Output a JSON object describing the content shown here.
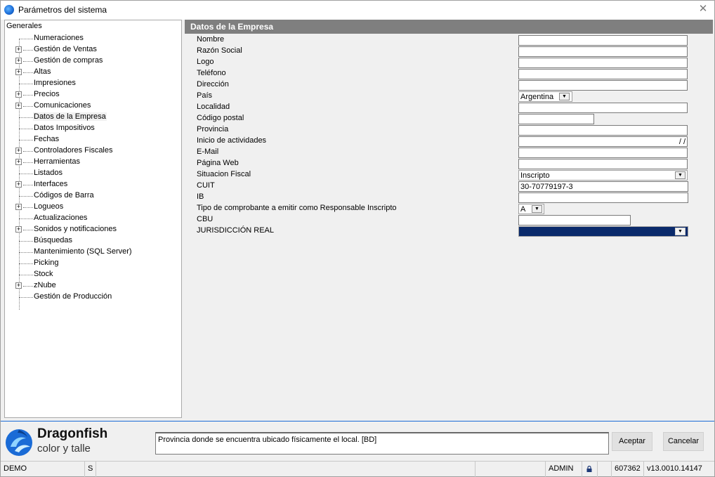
{
  "window": {
    "title": "Parámetros del sistema"
  },
  "tree": {
    "root": "Generales",
    "items": [
      {
        "label": "Numeraciones",
        "expandable": false
      },
      {
        "label": "Gestión de Ventas",
        "expandable": true
      },
      {
        "label": "Gestión de compras",
        "expandable": true
      },
      {
        "label": "Altas",
        "expandable": true
      },
      {
        "label": "Impresiones",
        "expandable": false
      },
      {
        "label": "Precios",
        "expandable": true
      },
      {
        "label": "Comunicaciones",
        "expandable": true
      },
      {
        "label": "Datos de la Empresa",
        "expandable": false,
        "selected": true
      },
      {
        "label": "Datos Impositivos",
        "expandable": false
      },
      {
        "label": "Fechas",
        "expandable": false
      },
      {
        "label": "Controladores Fiscales",
        "expandable": true
      },
      {
        "label": "Herramientas",
        "expandable": true
      },
      {
        "label": "Listados",
        "expandable": false
      },
      {
        "label": "Interfaces",
        "expandable": true
      },
      {
        "label": "Códigos de Barra",
        "expandable": false
      },
      {
        "label": "Logueos",
        "expandable": true
      },
      {
        "label": "Actualizaciones",
        "expandable": false
      },
      {
        "label": "Sonidos y notificaciones",
        "expandable": true
      },
      {
        "label": "Búsquedas",
        "expandable": false
      },
      {
        "label": "Mantenimiento (SQL Server)",
        "expandable": false
      },
      {
        "label": "Picking",
        "expandable": false
      },
      {
        "label": "Stock",
        "expandable": false
      },
      {
        "label": "zNube",
        "expandable": true
      },
      {
        "label": "Gestión de Producción",
        "expandable": false
      }
    ]
  },
  "section": {
    "title": "Datos de la Empresa",
    "fields": {
      "nombre": {
        "label": "Nombre",
        "value": ""
      },
      "razon_social": {
        "label": "Razón Social",
        "value": ""
      },
      "logo": {
        "label": "Logo",
        "value": ""
      },
      "telefono": {
        "label": "Teléfono",
        "value": ""
      },
      "direccion": {
        "label": "Dirección",
        "value": ""
      },
      "pais": {
        "label": "País",
        "value": "Argentina"
      },
      "localidad": {
        "label": "Localidad",
        "value": ""
      },
      "codigo_postal": {
        "label": "Código postal",
        "value": ""
      },
      "provincia": {
        "label": "Provincia",
        "value": ""
      },
      "inicio_actividades": {
        "label": "Inicio de actividades",
        "value": " / /"
      },
      "email": {
        "label": "E-Mail",
        "value": ""
      },
      "pagina_web": {
        "label": "Página Web",
        "value": ""
      },
      "situacion_fiscal": {
        "label": "Situacion Fiscal",
        "value": "Inscripto"
      },
      "cuit": {
        "label": "CUIT",
        "value": "30-70779197-3"
      },
      "ib": {
        "label": "IB",
        "value": ""
      },
      "tipo_comprobante": {
        "label": "Tipo de comprobante a emitir como Responsable Inscripto",
        "value": "A"
      },
      "cbu": {
        "label": "CBU",
        "value": ""
      },
      "jurisdiccion": {
        "label": "JURISDICCIÓN REAL",
        "value": ""
      }
    }
  },
  "footer": {
    "brand": "Dragonfish",
    "subtitle": "color y talle",
    "message": "Provincia donde se encuentra ubicado físicamente el local. [BD]",
    "accept_label": "Aceptar",
    "cancel_label": "Cancelar"
  },
  "statusbar": {
    "db": "DEMO",
    "mode": "S",
    "user": "ADMIN",
    "lock_icon": "lock-icon",
    "code": "607362",
    "version": "v13.0010.14147"
  },
  "colors": {
    "accent": "#1a6bd6",
    "header_bg": "#7f7f7f",
    "jurisdiccion_fill": "#0a2a6b"
  }
}
